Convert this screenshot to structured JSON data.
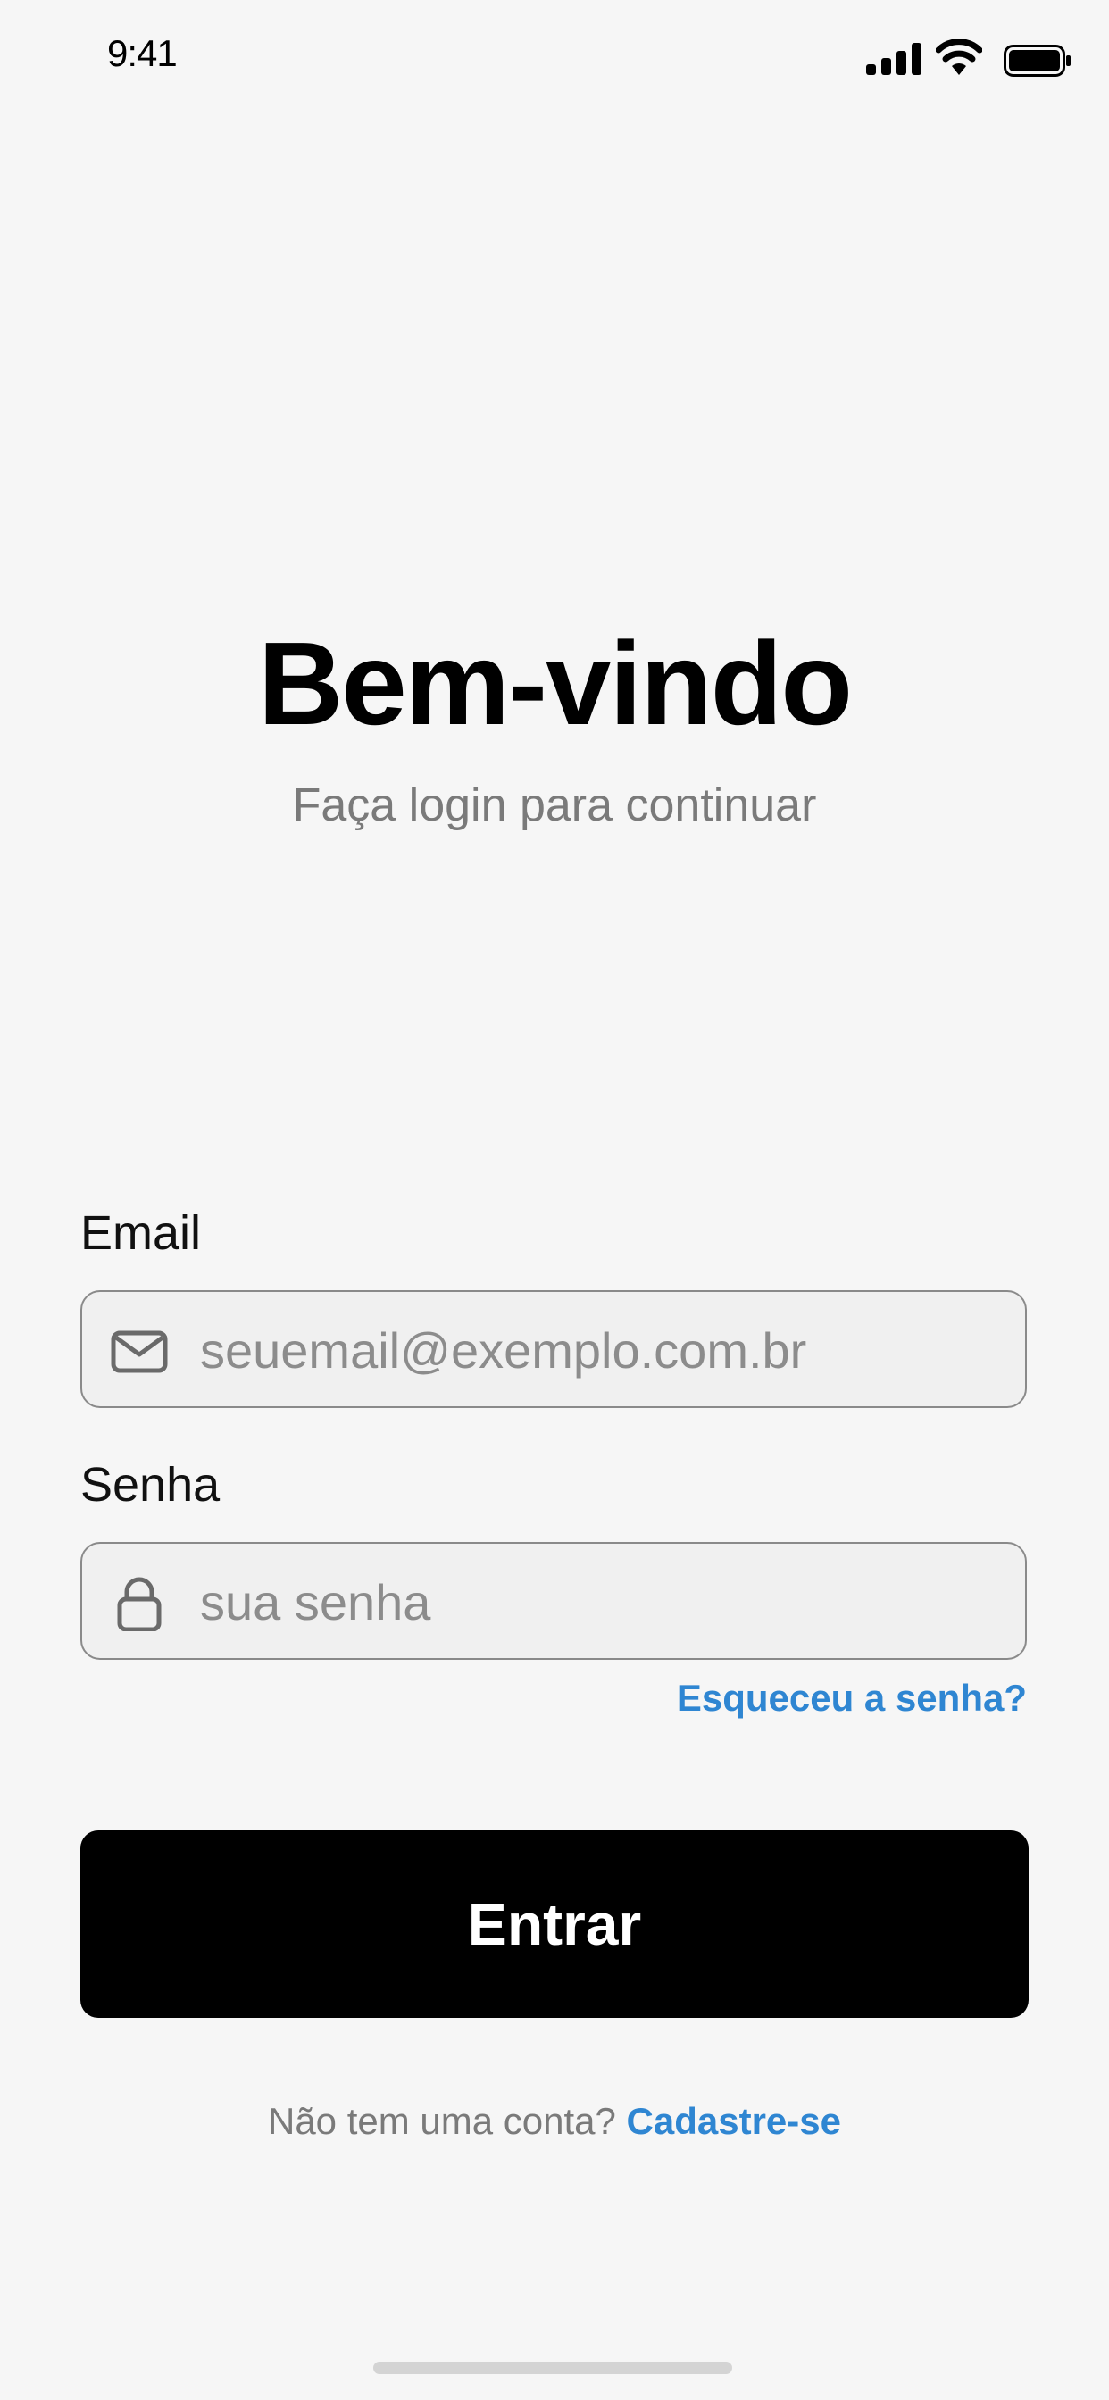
{
  "status_bar": {
    "time": "9:41",
    "icons": [
      "cellular-signal-icon",
      "wifi-icon",
      "battery-icon"
    ]
  },
  "header": {
    "title": "Bem-vindo",
    "subtitle": "Faça login para continuar"
  },
  "form": {
    "email": {
      "label": "Email",
      "placeholder": "seuemail@exemplo.com.br",
      "value": "",
      "icon": "envelope-icon"
    },
    "password": {
      "label": "Senha",
      "placeholder": "sua senha",
      "value": "",
      "icon": "lock-icon"
    },
    "forgot_link": "Esqueceu a senha?",
    "submit_label": "Entrar"
  },
  "footer": {
    "question": "Não tem uma conta?",
    "signup_link": "Cadastre-se"
  },
  "colors": {
    "background": "#f6f6f6",
    "accent_link": "#2f86d2",
    "primary_button": "#000000",
    "muted_text": "#7a7a7a"
  }
}
